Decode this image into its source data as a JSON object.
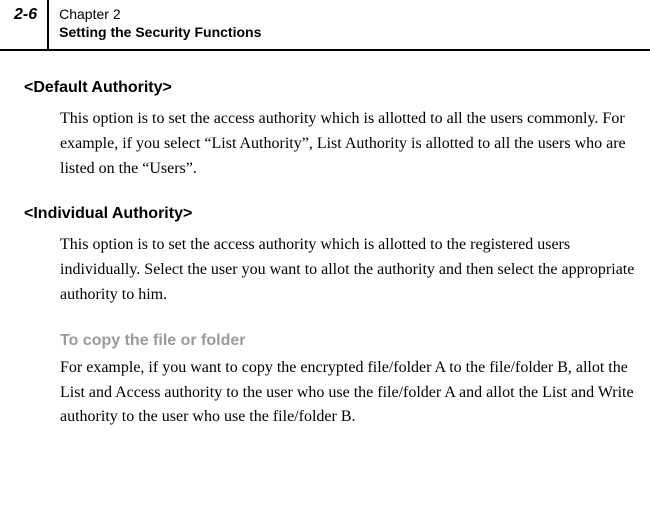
{
  "header": {
    "page_number": "2-6",
    "chapter_line": "Chapter 2",
    "chapter_title": "Setting the Security Functions"
  },
  "sections": {
    "default_authority": {
      "heading": "<Default Authority>",
      "body": "This option is to set the access authority which is allotted to all the users commonly. For example, if you select “List Authority”, List Authority is allotted to all the users who are listed on the “Users”."
    },
    "individual_authority": {
      "heading": "<Individual Authority>",
      "body": "This option is to set the access authority which is allotted to the registered users individually. Select the user you want to allot the authority and then select the appropriate authority to him."
    },
    "copy_file": {
      "heading": "To copy the file or folder",
      "body": "For example, if you want to copy the encrypted file/folder A to the file/folder B, allot the List and Access authority to the user who use the file/folder A and allot the List and Write authority to the user who use the file/folder B."
    }
  }
}
